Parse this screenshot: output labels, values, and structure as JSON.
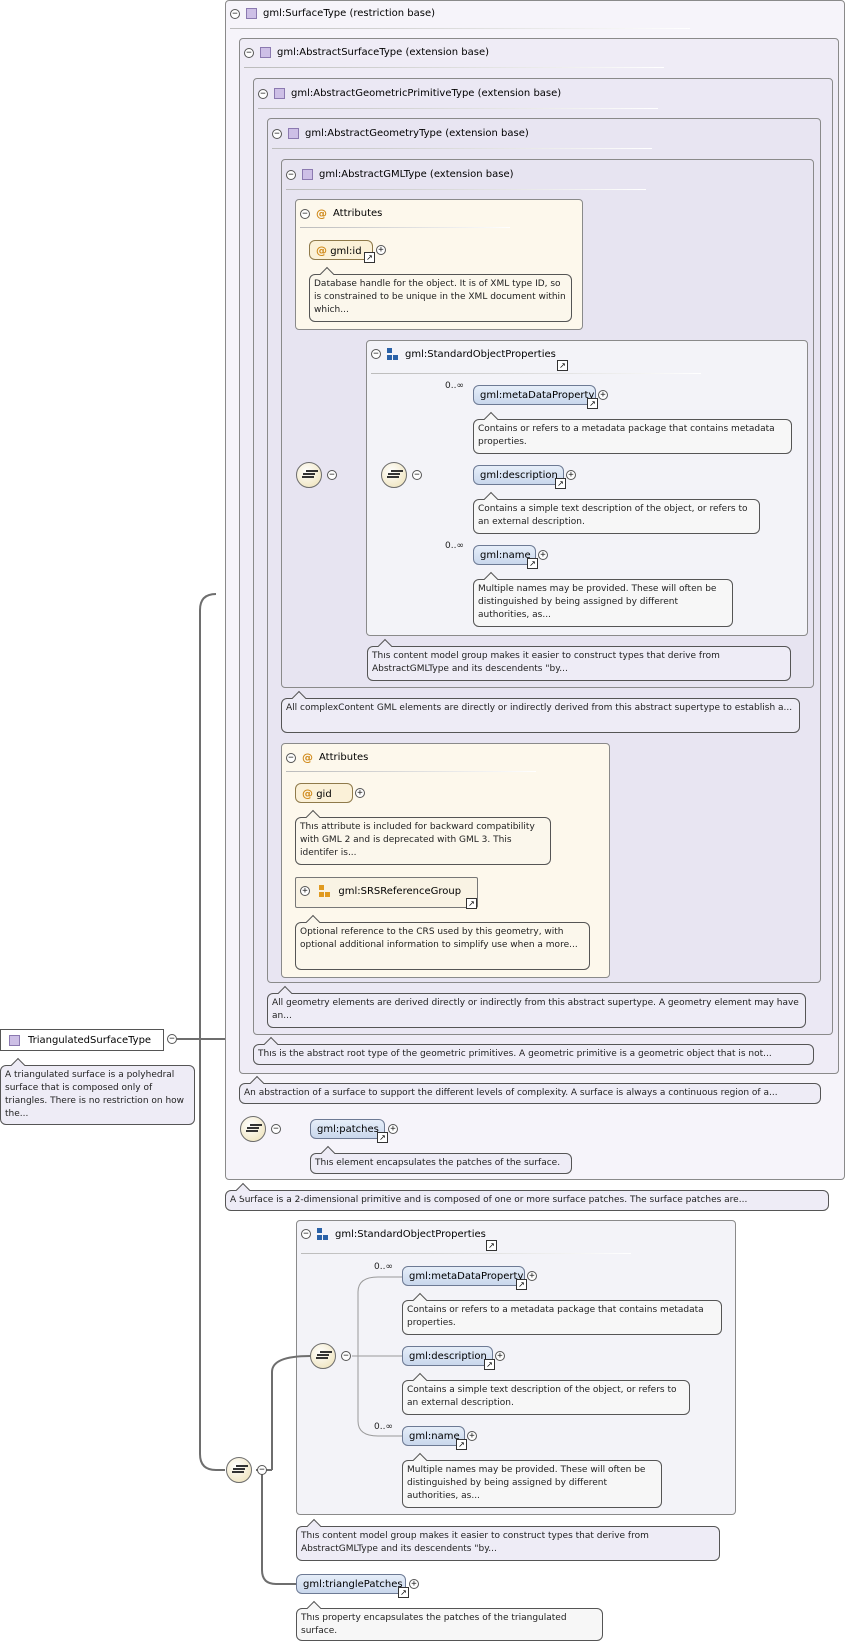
{
  "root": {
    "name": "TriangulatedSurfaceType",
    "doc": "A triangulated surface is a polyhedral surface that is composed only of triangles. There is no restriction on how the..."
  },
  "surface_type": {
    "header": "gml:SurfaceType (restriction base)",
    "doc": "A Surface is a 2-dimensional primitive and is composed of one or more surface patches. The surface patches are..."
  },
  "abstract_surface": {
    "header": "gml:AbstractSurfaceType (extension base)",
    "doc": "An abstraction of a surface to support the different levels of complexity. A surface is always a continuous region of a..."
  },
  "abstract_geo_prim": {
    "header": "gml:AbstractGeometricPrimitiveType (extension base)",
    "doc": "This is the abstract root type of the geometric primitives. A geometric primitive is a geometric object that is not..."
  },
  "abstract_geometry": {
    "header": "gml:AbstractGeometryType (extension base)",
    "doc": "All geometry elements are derived directly or indirectly from this abstract supertype. A geometry element may have an..."
  },
  "abstract_gml": {
    "header": "gml:AbstractGMLType (extension base)",
    "doc": "All complexContent GML elements are directly or indirectly derived from this abstract supertype to establish a..."
  },
  "attributes_label": "Attributes",
  "gml_id": {
    "name": "gml:id",
    "doc": "Database handle for the object. It is of XML type ID, so is constrained to be unique in the XML document within which..."
  },
  "std_obj_props_1": {
    "header": "gml:StandardObjectProperties",
    "doc": "This content model group makes it easier to construct types that derive from AbstractGMLType and its descendents \"by..."
  },
  "std_obj_props_2": {
    "header": "gml:StandardObjectProperties",
    "doc": "This content model group makes it easier to construct types that derive from AbstractGMLType and its descendents \"by..."
  },
  "meta_data_property": {
    "name": "gml:metaDataProperty",
    "card": "0..∞",
    "doc": "Contains or refers to a metadata package that contains metadata properties."
  },
  "description": {
    "name": "gml:description",
    "doc": "Contains a simple text description of the object, or refers to an external description."
  },
  "gml_name": {
    "name": "gml:name",
    "card": "0..∞",
    "doc": "Multiple names may be provided. These will often be distinguished by being assigned by different authorities, as..."
  },
  "gid": {
    "name": "gid",
    "doc": "This attribute is included for backward compatibility with GML 2 and is deprecated with GML 3. This identifer is..."
  },
  "srs_group": {
    "name": "gml:SRSReferenceGroup",
    "doc": "Optional reference to the CRS used by this geometry, with optional additional information to simplify use when a more..."
  },
  "patches": {
    "name": "gml:patches",
    "doc": "This element encapsulates the patches of the surface."
  },
  "triangle_patches": {
    "name": "gml:trianglePatches",
    "doc": "This property encapsulates the patches of the triangulated surface."
  },
  "icons": {
    "minus": "−",
    "plus": "+",
    "link": "↗",
    "attr": "@"
  }
}
